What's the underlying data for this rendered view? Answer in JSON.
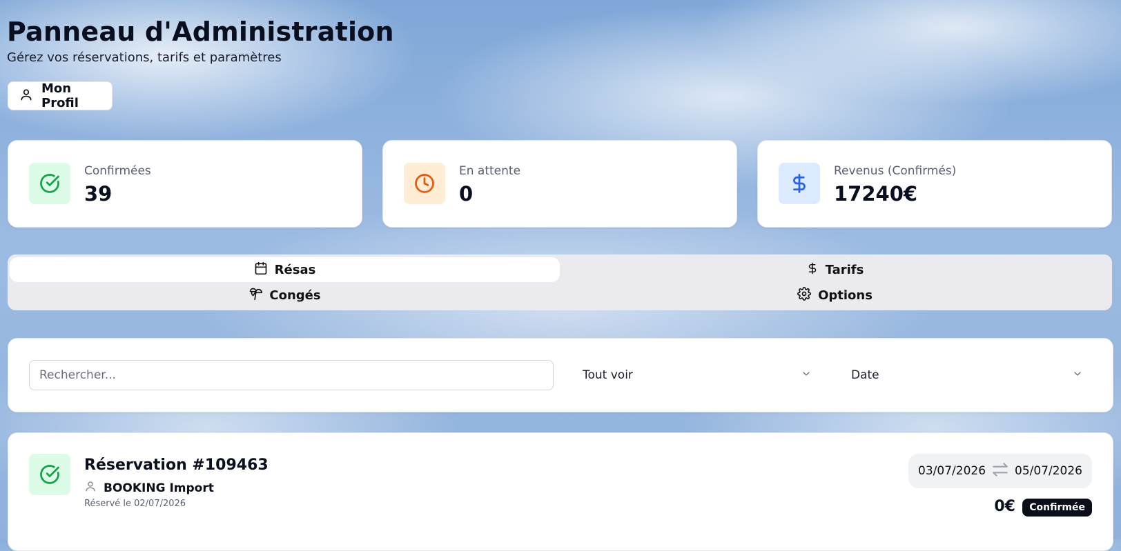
{
  "header": {
    "title": "Panneau d'Administration",
    "subtitle": "Gérez vos réservations, tarifs et paramètres"
  },
  "profile_button": {
    "label": "Mon Profil",
    "icon": "user-icon"
  },
  "stats": [
    {
      "label": "Confirmées",
      "value": "39",
      "icon": "check-circle-icon",
      "icon_color": "#16a34a",
      "icon_bg": "#dcfce7"
    },
    {
      "label": "En attente",
      "value": "0",
      "icon": "clock-icon",
      "icon_color": "#ea580c",
      "icon_bg": "#ffedd5"
    },
    {
      "label": "Revenus (Confirmés)",
      "value": "17240€",
      "icon": "dollar-icon",
      "icon_color": "#2563eb",
      "icon_bg": "#dbeafe"
    }
  ],
  "tabs": [
    {
      "label": "Résas",
      "icon": "calendar-icon",
      "active": true
    },
    {
      "label": "Tarifs",
      "icon": "dollar-icon",
      "active": false
    },
    {
      "label": "Congés",
      "icon": "palm-tree-icon",
      "active": false
    },
    {
      "label": "Options",
      "icon": "gear-icon",
      "active": false
    }
  ],
  "filters": {
    "search_placeholder": "Rechercher...",
    "search_value": "",
    "status_select": "Tout voir",
    "sort_select": "Date"
  },
  "reservations": [
    {
      "title": "Réservation #109463",
      "client": "BOOKING Import",
      "booked_on": "Réservé le 02/07/2026",
      "date_start": "03/07/2026",
      "date_end": "05/07/2026",
      "price": "0€",
      "status": "Confirmée",
      "icon": "check-circle-icon"
    }
  ],
  "colors": {
    "accent_dark": "#0b0f19",
    "success": "#16a34a",
    "warning": "#ea580c",
    "info": "#2563eb"
  }
}
